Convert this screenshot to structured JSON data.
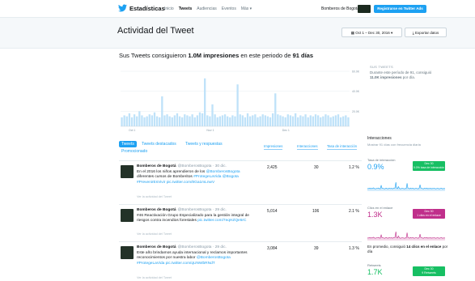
{
  "nav": {
    "brand": "Estadísticas",
    "links": [
      "Inicio",
      "Tweets",
      "Audiencias",
      "Eventos",
      "Más ▾"
    ],
    "account": "Bomberos de Bogotá ▾",
    "promo_button": "Registrarse en Twitter Ads"
  },
  "header": {
    "title": "Actividad del Tweet",
    "date_range": "▦ Oct 1 – Dec 30, 2016 ▾",
    "export": "⤓ Exportar datos"
  },
  "summary": {
    "prefix": "Sus Tweets consiguieron ",
    "impressions": "1.0M impresiones",
    "middle": " en este periodo de ",
    "days": "91 días"
  },
  "side_summary": {
    "label": "SUS TWEETS",
    "line1": "Durante este período de 91, consiguió",
    "line2_bold": "11.0K impresiones",
    "line2_rest": " por día."
  },
  "chart_data": {
    "type": "bar",
    "ylim": [
      0,
      60000
    ],
    "yticks": [
      "60.0K",
      "40.0K",
      "20.0K"
    ],
    "xticks": [
      "Oct 1",
      "Nov 1",
      "Dec 1"
    ],
    "grid": true,
    "color_organic": "#bfe2f9",
    "values": [
      9,
      11,
      10,
      13,
      9,
      12,
      10,
      15,
      11,
      9,
      10,
      12,
      11,
      14,
      10,
      9,
      30,
      11,
      12,
      10,
      9,
      11,
      13,
      10,
      9,
      12,
      11,
      10,
      12,
      9,
      11,
      14,
      13,
      48,
      11,
      10,
      22,
      12,
      9,
      10,
      11,
      12,
      10,
      9,
      11,
      10,
      42,
      12,
      11,
      9,
      13,
      10,
      11,
      12,
      9,
      10,
      12,
      11,
      10,
      9,
      13,
      33,
      12,
      11,
      10,
      9,
      12,
      11,
      10,
      13,
      9,
      11,
      10,
      12,
      9,
      11,
      10,
      12,
      11,
      9,
      10,
      12,
      11,
      9,
      10,
      11,
      12,
      9,
      10,
      11,
      9
    ]
  },
  "tabs": {
    "tweets": "Tweets",
    "top": "Tweets destacados",
    "replies": "Tweets y respuestas",
    "promoted": "Promocionado"
  },
  "columns": {
    "impressions": "Impresiones",
    "interactions": "Interacciones",
    "rate": "Tasa de interacción"
  },
  "tweets": [
    {
      "name": "Bomberos de Bogotá",
      "handle": "@BomberosBogota · 30 dic.",
      "text_before": "En el 2016 los niños aprendieron de los ",
      "link1": "@BomberosBogota",
      "text_mid": " diferentes cursos de Bomberitos ",
      "link2": "#ProtegeLaVida @Bogota #PrevenirEsVivir pic.twitter.com/8Ga1mLnwV",
      "detail": "Ver la actividad del Tweet",
      "impressions": "2,425",
      "interactions": "30",
      "rate": "1.2 %"
    },
    {
      "name": "Bomberos de Bogotá",
      "handle": "@BomberosBogota · 29 dic.",
      "text_before": "#46 Reactivación Grupo Especializado para la gestión integral de riesgos contra incendios forestales ",
      "link1": "",
      "text_mid": "",
      "link2": "pic.twitter.com/7eqHZQe5rC",
      "detail": "Ver la actividad del Tweet",
      "impressions": "5,014",
      "interactions": "106",
      "rate": "2.1 %"
    },
    {
      "name": "Bomberos de Bogotá",
      "handle": "@BomberosBogota · 29 dic.",
      "text_before": "Este año brindamos ayuda internacional y reclamos importantes reconocimientos por nuestra labor ",
      "link1": "@BomberosBogota #ProtegeLaVida",
      "text_mid": " ",
      "link2": "pic.twitter.com/qUNWbRNdT",
      "detail": "Ver la actividad del Tweet",
      "impressions": "3,084",
      "interactions": "39",
      "rate": "1.3 %"
    }
  ],
  "side_panel": {
    "title": "Interacciones",
    "subtitle": "Mostrar 91 días con frecuencia diaria",
    "metrics": [
      {
        "label": "Tasa de interacción",
        "value": "0.9%",
        "badge_line1": "Dec 30",
        "badge_line2": "0.0% tasa de interacción"
      },
      {
        "label": "Clics en el enlace",
        "value": "1.3K",
        "badge_line1": "Dec 30",
        "badge_line2": "1 clics en el enlace"
      },
      {
        "label": "Retweets",
        "value": "1.7K",
        "badge_line1": "Dec 30",
        "badge_line2": "9 Retweets"
      }
    ],
    "note_prefix": "En promedio, consiguió ",
    "note_bold": "14 clics en el enlace",
    "note_suffix": " por día"
  }
}
